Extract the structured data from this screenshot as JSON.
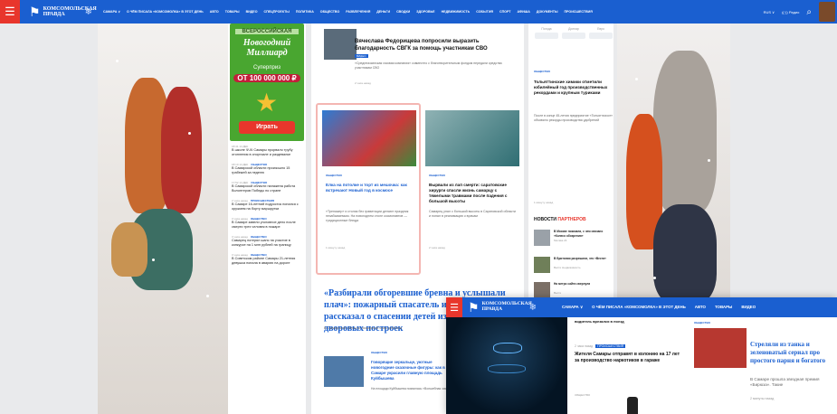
{
  "header": {
    "menu_icon": "hamburger-icon",
    "logo_text": "Комсомольская правда",
    "nav": [
      "САМАРА ∨",
      "О ЧЁМ ПИСАЛА «КОМСОМОЛКА» В ЭТОТ ДЕНЬ",
      "АВТО",
      "ТОВАРЫ",
      "ВИДЕО",
      "СПЕЦПРОЕКТЫ",
      "ПОЛИТИКА",
      "ОБЩЕСТВО",
      "РАЗВЛЕЧЕНИЯ",
      "ДЕНЬГИ",
      "СВОДКИ",
      "ЗДОРОВЬЕ",
      "НЕДВИЖИМОСТЬ",
      "СОБЫТИЯ",
      "СПОРТ",
      "АФИША",
      "ДОКУМЕНТЫ",
      "ПРОИСШЕСТВИЯ"
    ],
    "region_btn": "RUS ∨",
    "radio_btn": "((·)) Радио",
    "search_icon": "search-icon"
  },
  "ad": {
    "subtitle": "ВСЕРОССИЙСКАЯ",
    "title": "Новогодний Миллиард",
    "prize_label": "Суперприз",
    "prize_amount": "ОТ 100 000 000 ₽",
    "play_button": "Играть"
  },
  "feed": [
    {
      "time": "18:41 14 ДЕК",
      "tag": "",
      "text": "В школе ЧЧЧ Самары прорвало трубу отопления в спортзале и раздевалке"
    },
    {
      "time": "18:10 14 ДЕК",
      "tag": "ОБЩЕСТВО",
      "text": "В Самарской области произошло 15 грабежей за неделю"
    },
    {
      "time": "17:52 14 ДЕК",
      "tag": "ОБЩЕСТВО",
      "text": "В Самарской области налажена работа Волонтеров Победы по стране"
    },
    {
      "time": "2 часа назад",
      "tag": "ПРОИСШЕСТВИЯ",
      "text": "В Самаре 16-летний подросток попался с оружием на борту маршрутки"
    },
    {
      "time": "3 часа назад",
      "tag": "ОБЩЕСТВО",
      "text": "В Самаре завели уголовное дело после смерти трех человек в пожаре"
    },
    {
      "time": "3 часа назад",
      "tag": "ОБЩЕСТВО",
      "text": "Самарец потерял шанс на участие в конкурсе на 1 млн рублей на границу"
    },
    {
      "time": "3 часа назад",
      "tag": "ОБЩЕСТВО",
      "text": "В Советском районе Самары 21-летняя девушка попала в аварию на дороге"
    }
  ],
  "top_news": {
    "title": "Вячеслава Федорищева попросили выразить благодарность СВГК за помощь участникам СВО",
    "tag": "ВИДЕО",
    "lead": "«Среднеазиатская газовая компания» совместно с благотворительным фондом передали средства участникам СВО",
    "time": "2 часа назад"
  },
  "cards": [
    {
      "tag": "ОБЩЕСТВО",
      "title": "Елка на потолке и торт из мешочка: как встречают Новый год в космосе",
      "lead": "«Тренажер» и столик без гравитации делают праздник незабываемым. На новогоднем столе космонавтов — традиционные блюда",
      "time": "1 минуту назад"
    },
    {
      "tag": "ОБЩЕСТВО",
      "title": "Вырвали из лап смерти: саратовские хирурги спасли жизнь самарцу с тяжелыми травмами после падения с большой высоты",
      "lead": "Самарец упал с большой высоты в Саратовской области и попал в реанимацию к врачам",
      "time": "2 часа назад"
    }
  ],
  "big_story": {
    "title": "«Разбирали обгоревшие бревна и услышали плач»: пожарный спасатель из Самары рассказал о спасении детей из горящих дворовых построек",
    "lead": "В Самарской области пожарный спас ребенка"
  },
  "bottom_news": {
    "tag": "ОБЩЕСТВО",
    "title": "Говорящие зеркальце, уютные новогодние сказочные фигуры: как в Самаре украсили главную площадь Куйбышева",
    "lead": "На площади Куйбышева появилась «Волшебная зима»"
  },
  "currency": [
    {
      "label": "Погода"
    },
    {
      "label": "Доллар"
    },
    {
      "label": "Евро"
    }
  ],
  "right_story": {
    "tag": "ОБЩЕСТВО",
    "title": "Тольяттинские химики отметили юбилейный год производственных рекордами и крупным туриками",
    "lead": "После в конце 45-летия предприятие «Тольяттиазот» объявило рекорды производства удобрений",
    "time": "1 минуту назад"
  },
  "partners": {
    "heading_left": "НОВОСТИ",
    "heading_right": "ПАРТНЕРОВ",
    "items": [
      {
        "title": "В Москве показали, с чем связано «Колесо обозрения»",
        "source": "Москва 24"
      },
      {
        "title": "В Британии разрешили, что «Вести»",
        "source": "Вести Недвижимость"
      },
      {
        "title": "На метро сайта свернули",
        "source": "Вести"
      }
    ]
  },
  "popup": {
    "nav": [
      "САМАРА ∨",
      "О ЧЁМ ПИСАЛА «КОМСОМОЛКА» В ЭТОТ ДЕНЬ",
      "АВТО",
      "ТОВАРЫ",
      "ВИДЕО"
    ],
    "top_line": "водитель врезался в поезд",
    "meta_time": "2 часа назад",
    "meta_tag": "ПРОИСШЕСТВИЯ",
    "headline": "Жителя Самары отправят в колонию на 17 лет за производство наркотиков в гараже",
    "small_tag": "ОБЩЕСТВО",
    "right_tag": "ОБЩЕСТВО",
    "right_title": "Стреляли из танка и зеленоватый сериал про простого парня и богатого",
    "right_lead": "В Самаре прошла звездная премия «Бирюза». Такие",
    "right_time": "2 минуты назад"
  }
}
